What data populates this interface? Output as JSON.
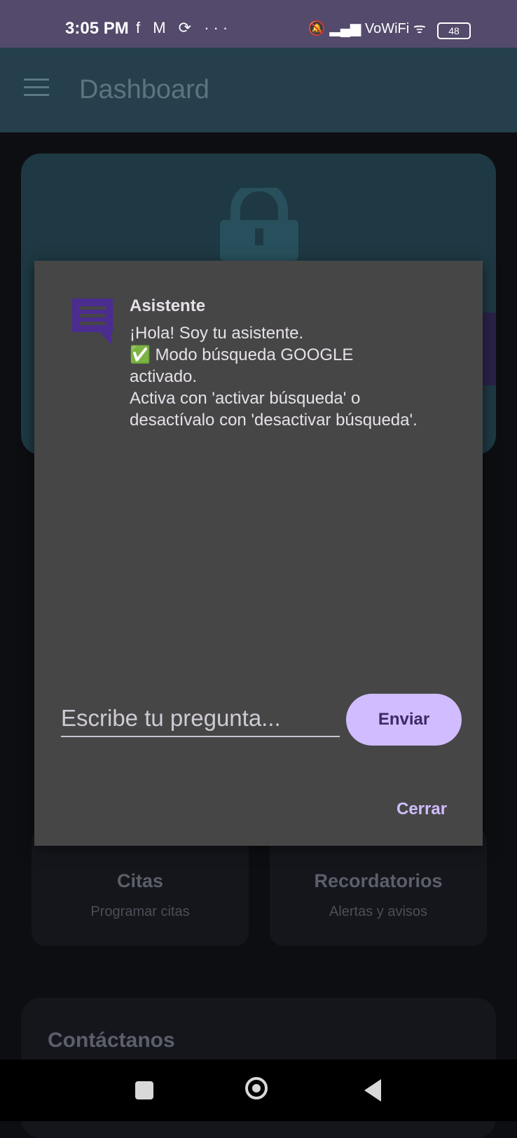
{
  "status_bar": {
    "time": "3:05 PM",
    "left_icons": [
      "facebook-icon",
      "gmail-icon",
      "sync-icon",
      "more-icon"
    ],
    "left_glyphs": "f M ⟳ ···",
    "right_glyphs": "🔕 ▂▄▆ VoWiFi ᯤ",
    "battery": "48"
  },
  "app_bar": {
    "title": "Dashboard"
  },
  "cards": [
    {
      "title": "Citas",
      "subtitle": "Programar citas"
    },
    {
      "title": "Recordatorios",
      "subtitle": "Alertas y avisos"
    }
  ],
  "contact": {
    "title": "Contáctanos"
  },
  "dialog": {
    "sender": "Asistente",
    "message": "¡Hola! Soy tu asistente.\n✅ Modo búsqueda GOOGLE activado.\nActiva con 'activar búsqueda' o desactívalo con 'desactivar búsqueda'.",
    "input_placeholder": "Escribe tu pregunta...",
    "send_label": "Enviar",
    "close_label": "Cerrar"
  },
  "colors": {
    "status_bar": "#544a6b",
    "app_bar": "#253f4c",
    "dialog_bg": "#464646",
    "accent": "#d0bcfe",
    "chat_icon": "#4b2c8f"
  }
}
